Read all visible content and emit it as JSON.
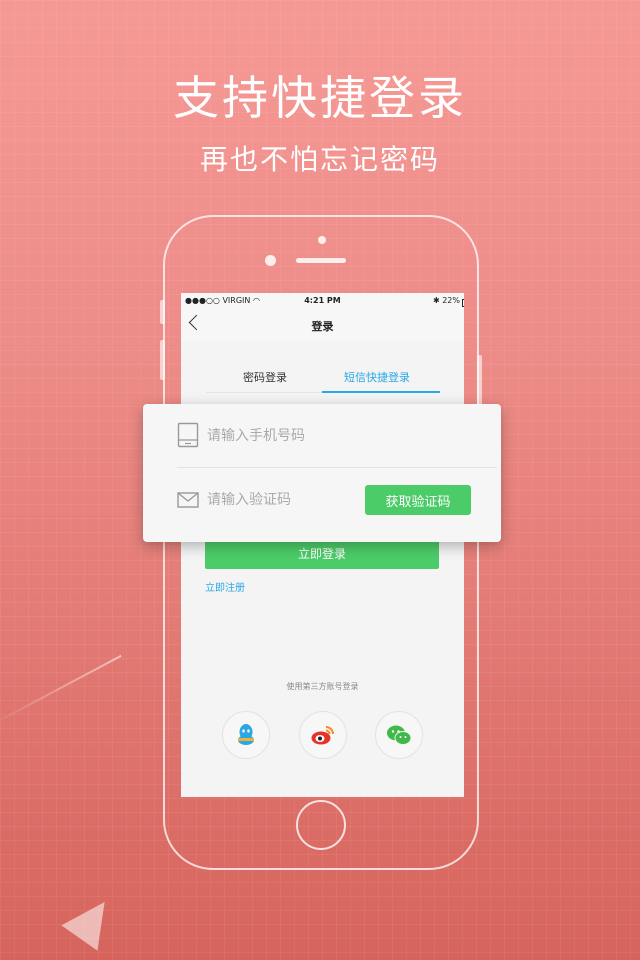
{
  "promo": {
    "headline": "支持快捷登录",
    "subline": "再也不怕忘记密码"
  },
  "status_bar": {
    "carrier": "●●●○○ VIRGIN",
    "time": "4:21 PM",
    "battery": "22%"
  },
  "nav": {
    "title": "登录"
  },
  "tabs": [
    {
      "label": "密码登录",
      "active": false
    },
    {
      "label": "短信快捷登录",
      "active": true
    }
  ],
  "form": {
    "phone_placeholder": "请输入手机号码",
    "code_placeholder": "请输入验证码",
    "get_code_label": "获取验证码",
    "login_label": "立即登录",
    "register_label": "立即注册"
  },
  "third_party": {
    "label": "使用第三方账号登录",
    "providers": [
      "qq-icon",
      "weibo-icon",
      "wechat-icon"
    ]
  },
  "colors": {
    "accent_blue": "#2aa7e6",
    "accent_green": "#4ccc68",
    "background": "#ec8a86"
  }
}
